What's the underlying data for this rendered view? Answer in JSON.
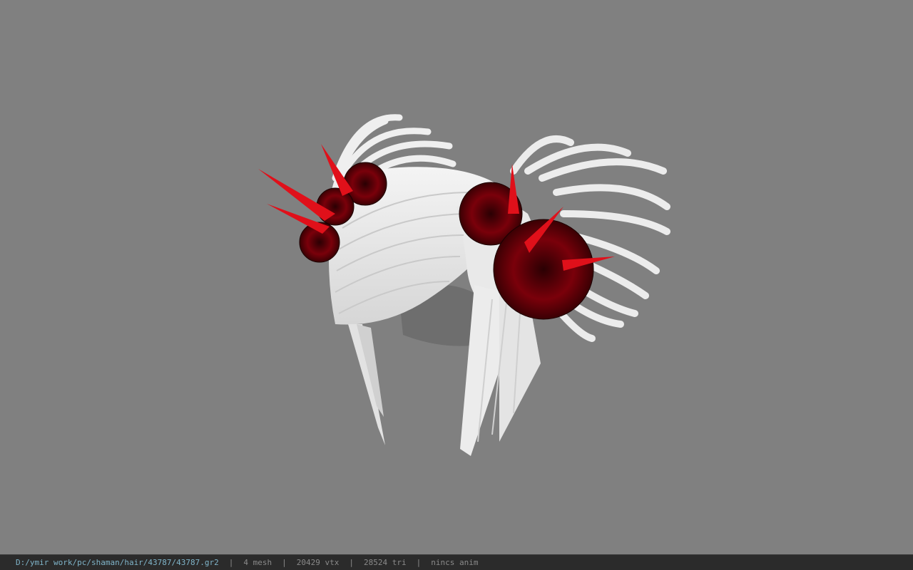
{
  "viewport": {
    "background": "#808080",
    "model_icon": "hair-model-icon"
  },
  "statusbar": {
    "file_path": "D:/ymir work/pc/shaman/hair/43787/43787.gr2",
    "separator": "|",
    "mesh": "4 mesh",
    "vertices": "20429 vtx",
    "triangles": "28524 tri",
    "anim": "nincs anim"
  },
  "colors": {
    "statusbar_bg": "#2b2b2b",
    "path_text": "#7fb4c9",
    "stat_text": "#8a8a8a",
    "hair": "#e8e8e8",
    "flower": "#6b0008",
    "spike": "#e0101a"
  }
}
